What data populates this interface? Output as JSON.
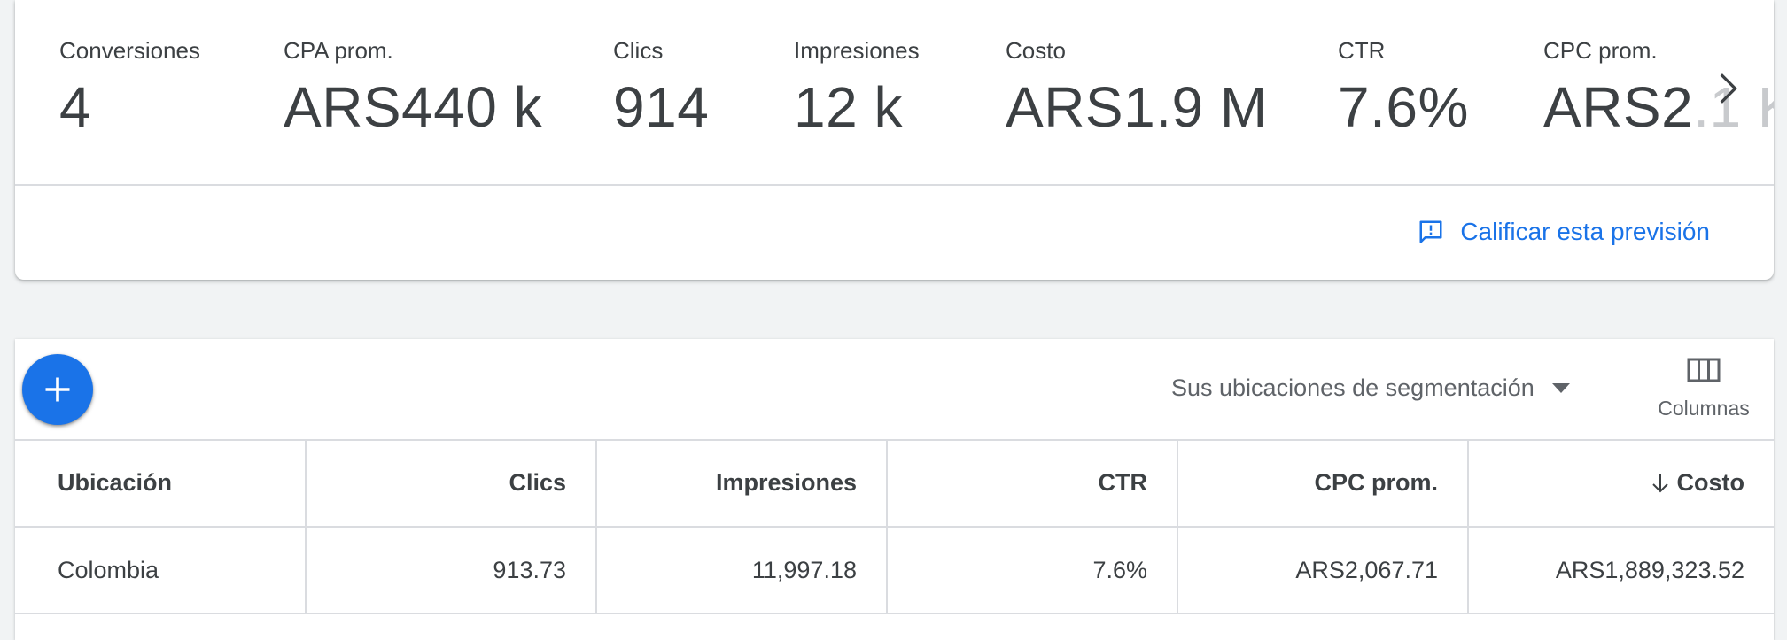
{
  "summary": {
    "metrics": [
      {
        "label": "Conversiones",
        "value": "4"
      },
      {
        "label": "CPA prom.",
        "value": "ARS440 k"
      },
      {
        "label": "Clics",
        "value": "914"
      },
      {
        "label": "Impresiones",
        "value": "12 k"
      },
      {
        "label": "Costo",
        "value": "ARS1.9 M"
      },
      {
        "label": "CTR",
        "value": "7.6%"
      },
      {
        "label": "CPC prom.",
        "value_visible": "ARS2",
        "value_faded": ".1 K"
      }
    ],
    "rate_link": "Calificar esta previsión",
    "next_icon": "chevron-right-icon",
    "feedback_icon": "feedback-icon"
  },
  "toolbar": {
    "add_icon": "add-icon",
    "segment_select": "Sus ubicaciones de segmentación",
    "columns_label": "Columnas",
    "columns_icon": "columns-icon"
  },
  "table": {
    "headers": [
      "Ubicación",
      "Clics",
      "Impresiones",
      "CTR",
      "CPC prom.",
      "Costo"
    ],
    "sort_icon": "arrow-down-icon",
    "rows": [
      [
        "Colombia",
        "913.73",
        "11,997.18",
        "7.6%",
        "ARS2,067.71",
        "ARS1,889,323.52"
      ]
    ]
  },
  "colors": {
    "accent": "#1a73e8",
    "text": "#3c4043",
    "divider": "#dadce0",
    "background": "#f1f3f4"
  }
}
